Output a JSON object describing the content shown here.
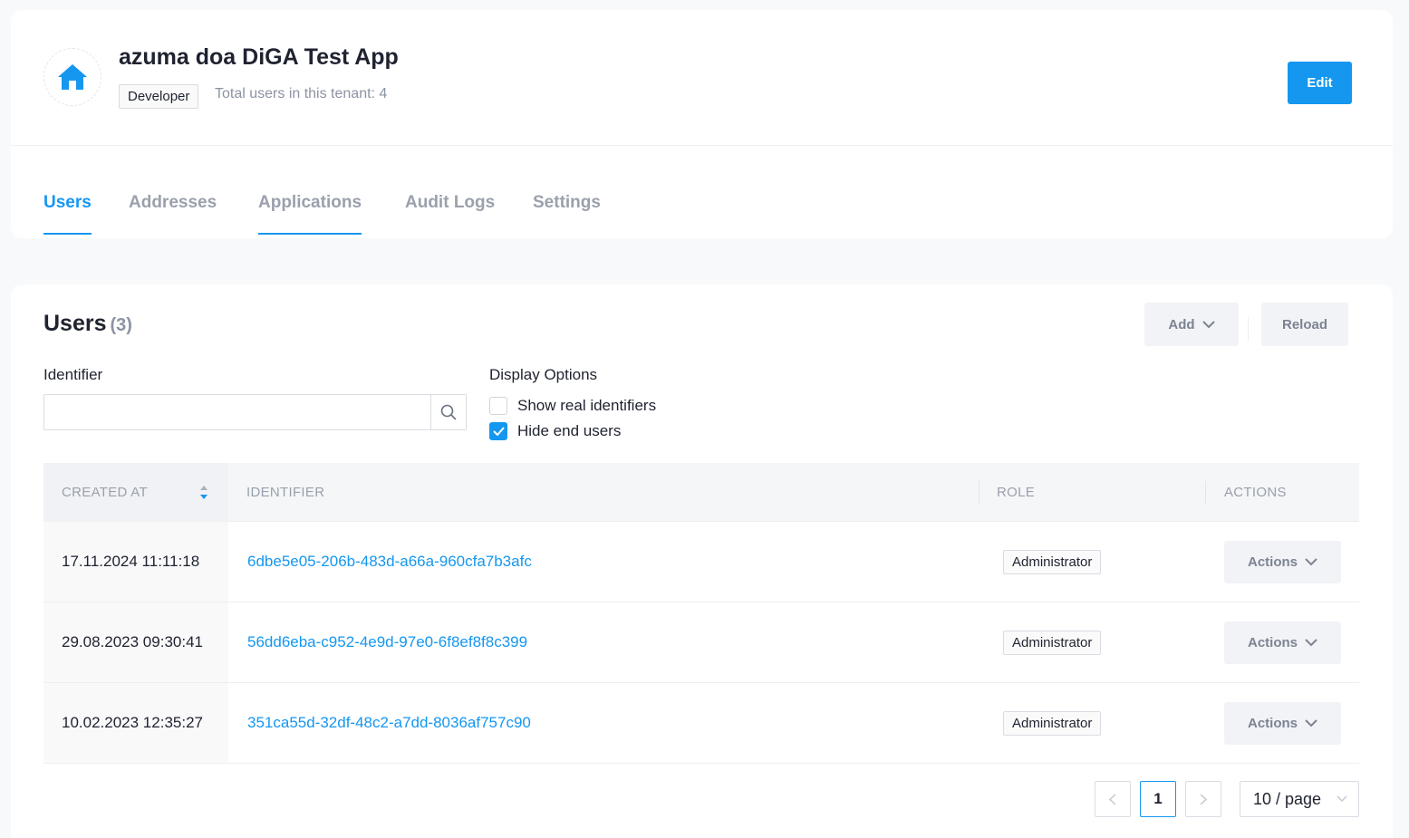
{
  "header": {
    "icon": "home-icon",
    "title": "azuma doa DiGA Test App",
    "role": "Developer",
    "user_count_text": "Total users in this tenant: 4",
    "edit_label": "Edit"
  },
  "tabs": [
    {
      "label": "Users",
      "active": true
    },
    {
      "label": "Addresses",
      "active": false
    },
    {
      "label": "Applications",
      "active": false
    },
    {
      "label": "Audit Logs",
      "active": false
    },
    {
      "label": "Settings",
      "active": false
    }
  ],
  "users": {
    "title": "Users",
    "count": "(3)",
    "add_label": "Add",
    "reload_label": "Reload",
    "identifier_label": "Identifier",
    "identifier_value": "",
    "display_options_label": "Display Options",
    "options": [
      {
        "label": "Show real identifiers",
        "checked": false
      },
      {
        "label": "Hide end users",
        "checked": true
      }
    ],
    "columns": [
      "CREATED AT",
      "IDENTIFIER",
      "ROLE",
      "ACTIONS"
    ],
    "rows": [
      {
        "created_at": "17.11.2024 11:11:18",
        "identifier": "6dbe5e05-206b-483d-a66a-960cfa7b3afc",
        "role": "Administrator",
        "action": "Actions"
      },
      {
        "created_at": "29.08.2023 09:30:41",
        "identifier": "56dd6eba-c952-4e9d-97e0-6f8ef8f8c399",
        "role": "Administrator",
        "action": "Actions"
      },
      {
        "created_at": "10.02.2023 12:35:27",
        "identifier": "351ca55d-32df-48c2-a7dd-8036af757c90",
        "role": "Administrator",
        "action": "Actions"
      }
    ],
    "pagination": {
      "current_page": "1",
      "page_size": "10 / page"
    }
  },
  "colors": {
    "accent": "#1597f0",
    "muted": "#9aa0ac",
    "text": "#1f2330"
  }
}
